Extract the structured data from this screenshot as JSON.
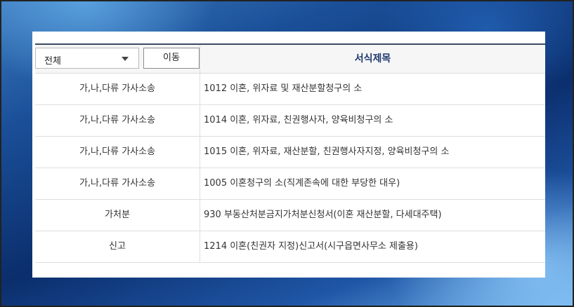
{
  "toolbar": {
    "select_value": "전체",
    "go_button_label": "이동",
    "column_title": "서식제목"
  },
  "rows": [
    {
      "category": "가,나,다류 가사소송",
      "title": "1012 이혼, 위자료 및 재산분할청구의 소"
    },
    {
      "category": "가,나,다류 가사소송",
      "title": "1014 이혼, 위자료, 친권행사자, 양육비청구의 소"
    },
    {
      "category": "가,나,다류 가사소송",
      "title": "1015 이혼, 위자료, 재산분할, 친권행사자지정, 양육비청구의 소"
    },
    {
      "category": "가,나,다류 가사소송",
      "title": "1005 이혼청구의 소(직계존속에 대한 부당한 대우)"
    },
    {
      "category": "가처분",
      "title": "930 부동산처분금지가처분신청서(이혼 재산분할, 다세대주택)"
    },
    {
      "category": "신고",
      "title": "1214 이혼(친권자 지정)신고서(시구읍면사무소 제출용)"
    }
  ]
}
